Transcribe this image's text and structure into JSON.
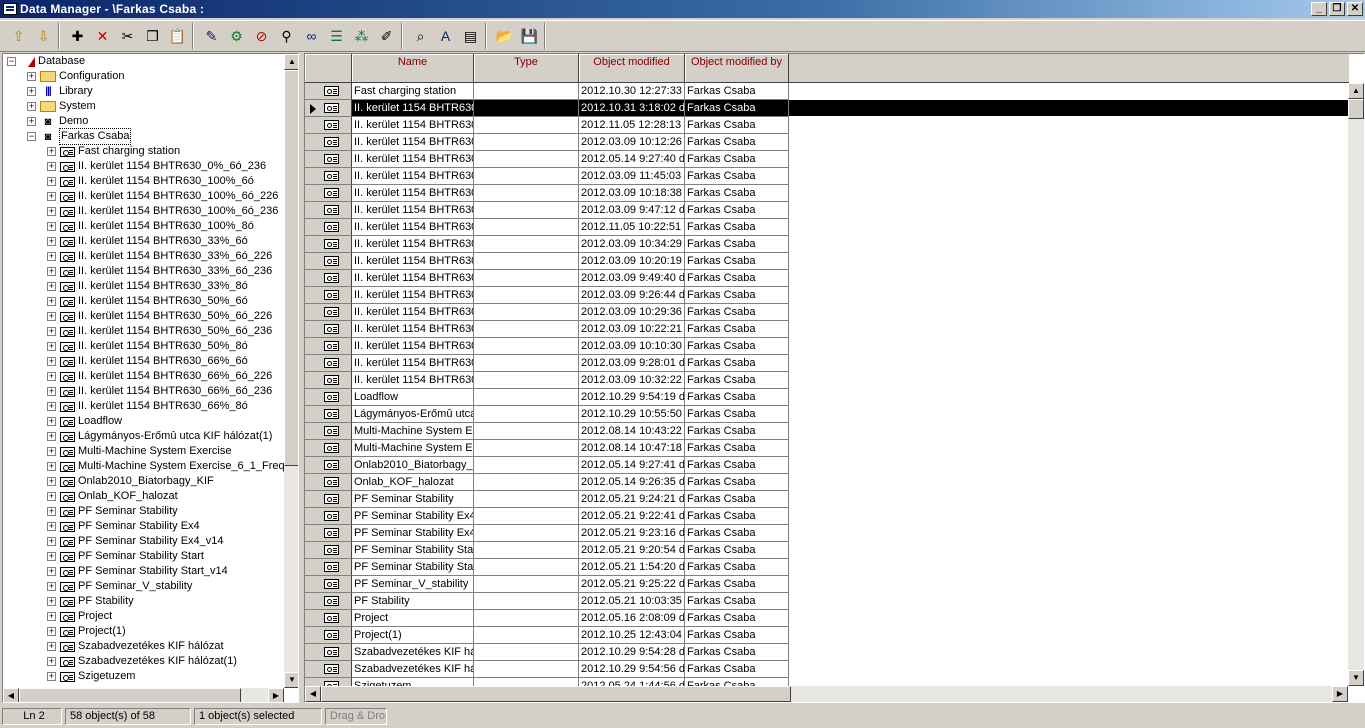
{
  "window": {
    "title": "Data Manager - \\Farkas Csaba :",
    "buttons": [
      "minimize",
      "restore",
      "close"
    ]
  },
  "toolbar": {
    "groups": [
      [
        {
          "icon": "folder-up-icon",
          "glyph": "⇧"
        },
        {
          "icon": "folder-down-icon",
          "glyph": "⇩"
        }
      ],
      [
        {
          "icon": "new-object-icon",
          "glyph": "✚"
        },
        {
          "icon": "delete-icon",
          "glyph": "✕"
        },
        {
          "icon": "cut-icon",
          "glyph": "✂"
        },
        {
          "icon": "copy-icon",
          "glyph": "❐"
        },
        {
          "icon": "paste-icon",
          "glyph": "📋"
        }
      ],
      [
        {
          "icon": "edit-icon",
          "glyph": "✎"
        },
        {
          "icon": "settings-icon",
          "glyph": "⚙"
        },
        {
          "icon": "no-entry-icon",
          "glyph": "⊘"
        },
        {
          "icon": "find-user-icon",
          "glyph": "⚲"
        },
        {
          "icon": "glasses-icon",
          "glyph": "∞"
        },
        {
          "icon": "filter-icon",
          "glyph": "☰"
        },
        {
          "icon": "network-icon",
          "glyph": "⁂"
        },
        {
          "icon": "note-icon",
          "glyph": "✐"
        }
      ],
      [
        {
          "icon": "binoculars-icon",
          "glyph": "⌕"
        },
        {
          "icon": "font-icon",
          "glyph": "A"
        },
        {
          "icon": "report-icon",
          "glyph": "▤"
        }
      ],
      [
        {
          "icon": "open-folder-icon",
          "glyph": "📂"
        },
        {
          "icon": "save-icon",
          "glyph": "💾"
        }
      ]
    ]
  },
  "tree": {
    "root": "Database",
    "top_items": [
      {
        "label": "Configuration",
        "icon": "folder"
      },
      {
        "label": "Library",
        "icon": "library"
      },
      {
        "label": "System",
        "icon": "folder"
      },
      {
        "label": "Demo",
        "icon": "user"
      }
    ],
    "user": {
      "label": "Farkas Csaba",
      "selected": true
    },
    "children": [
      "Fast charging station",
      "II. kerület 1154 BHTR630_0%_6ó_236",
      "II. kerület 1154 BHTR630_100%_6ó",
      "II. kerület 1154 BHTR630_100%_6ó_226",
      "II. kerület 1154 BHTR630_100%_6ó_236",
      "II. kerület 1154 BHTR630_100%_8ó",
      "II. kerület 1154 BHTR630_33%_6ó",
      "II. kerület 1154 BHTR630_33%_6ó_226",
      "II. kerület 1154 BHTR630_33%_6ó_236",
      "II. kerület 1154 BHTR630_33%_8ó",
      "II. kerület 1154 BHTR630_50%_6ó",
      "II. kerület 1154 BHTR630_50%_6ó_226",
      "II. kerület 1154 BHTR630_50%_6ó_236",
      "II. kerület 1154 BHTR630_50%_8ó",
      "II. kerület 1154 BHTR630_66%_6ó",
      "II. kerület 1154 BHTR630_66%_6ó_226",
      "II. kerület 1154 BHTR630_66%_6ó_236",
      "II. kerület 1154 BHTR630_66%_8ó",
      "Loadflow",
      "Lágymányos-Erőmû utca KIF hálózat(1)",
      "Multi-Machine System Exercise",
      "Multi-Machine System Exercise_6_1_Freq",
      "Onlab2010_Biatorbagy_KIF",
      "Onlab_KOF_halozat",
      "PF Seminar Stability",
      "PF Seminar Stability Ex4",
      "PF Seminar Stability Ex4_v14",
      "PF Seminar Stability Start",
      "PF Seminar Stability Start_v14",
      "PF Seminar_V_stability",
      "PF Stability",
      "Project",
      "Project(1)",
      "Szabadvezetékes KIF hálózat",
      "Szabadvezetékes KIF hálózat(1)",
      "Szigetuzem"
    ]
  },
  "grid": {
    "columns": [
      "Name",
      "Type",
      "Object modified",
      "Object modified by"
    ],
    "selected_row": 1,
    "rows": [
      [
        "Fast charging station",
        "",
        "2012.10.30 12:27:33",
        "Farkas Csaba"
      ],
      [
        "II. kerület 1154 BHTR630",
        "",
        "2012.10.31 3:18:02 d",
        "Farkas Csaba"
      ],
      [
        "II. kerület 1154 BHTR630",
        "",
        "2012.11.05 12:28:13",
        "Farkas Csaba"
      ],
      [
        "II. kerület 1154 BHTR630",
        "",
        "2012.03.09 10:12:26",
        "Farkas Csaba"
      ],
      [
        "II. kerület 1154 BHTR630",
        "",
        "2012.05.14 9:27:40 d",
        "Farkas Csaba"
      ],
      [
        "II. kerület 1154 BHTR630",
        "",
        "2012.03.09 11:45:03",
        "Farkas Csaba"
      ],
      [
        "II. kerület 1154 BHTR630",
        "",
        "2012.03.09 10:18:38",
        "Farkas Csaba"
      ],
      [
        "II. kerület 1154 BHTR630",
        "",
        "2012.03.09 9:47:12 d",
        "Farkas Csaba"
      ],
      [
        "II. kerület 1154 BHTR630",
        "",
        "2012.11.05 10:22:51",
        "Farkas Csaba"
      ],
      [
        "II. kerület 1154 BHTR630",
        "",
        "2012.03.09 10:34:29",
        "Farkas Csaba"
      ],
      [
        "II. kerület 1154 BHTR630",
        "",
        "2012.03.09 10:20:19",
        "Farkas Csaba"
      ],
      [
        "II. kerület 1154 BHTR630",
        "",
        "2012.03.09 9:49:40 d",
        "Farkas Csaba"
      ],
      [
        "II. kerület 1154 BHTR630",
        "",
        "2012.03.09 9:26:44 d",
        "Farkas Csaba"
      ],
      [
        "II. kerület 1154 BHTR630",
        "",
        "2012.03.09 10:29:36",
        "Farkas Csaba"
      ],
      [
        "II. kerület 1154 BHTR630",
        "",
        "2012.03.09 10:22:21",
        "Farkas Csaba"
      ],
      [
        "II. kerület 1154 BHTR630",
        "",
        "2012.03.09 10:10:30",
        "Farkas Csaba"
      ],
      [
        "II. kerület 1154 BHTR630",
        "",
        "2012.03.09 9:28:01 d",
        "Farkas Csaba"
      ],
      [
        "II. kerület 1154 BHTR630",
        "",
        "2012.03.09 10:32:22",
        "Farkas Csaba"
      ],
      [
        "Loadflow",
        "",
        "2012.10.29 9:54:19 d",
        "Farkas Csaba"
      ],
      [
        "Lágymányos-Erőmû utca",
        "",
        "2012.10.29 10:55:50",
        "Farkas Csaba"
      ],
      [
        "Multi-Machine System Ex",
        "",
        "2012.08.14 10:43:22",
        "Farkas Csaba"
      ],
      [
        "Multi-Machine System Ex",
        "",
        "2012.08.14 10:47:18",
        "Farkas Csaba"
      ],
      [
        "Onlab2010_Biatorbagy_K",
        "",
        "2012.05.14 9:27:41 d",
        "Farkas Csaba"
      ],
      [
        "Onlab_KOF_halozat",
        "",
        "2012.05.14 9:26:35 d",
        "Farkas Csaba"
      ],
      [
        "PF Seminar Stability",
        "",
        "2012.05.21 9:24:21 d",
        "Farkas Csaba"
      ],
      [
        "PF Seminar Stability Ex4",
        "",
        "2012.05.21 9:22:41 d",
        "Farkas Csaba"
      ],
      [
        "PF Seminar Stability Ex4_",
        "",
        "2012.05.21 9:23:16 d",
        "Farkas Csaba"
      ],
      [
        "PF Seminar Stability Start",
        "",
        "2012.05.21 9:20:54 d",
        "Farkas Csaba"
      ],
      [
        "PF Seminar Stability Start",
        "",
        "2012.05.21 1:54:20 d",
        "Farkas Csaba"
      ],
      [
        "PF Seminar_V_stability",
        "",
        "2012.05.21 9:25:22 d",
        "Farkas Csaba"
      ],
      [
        "PF Stability",
        "",
        "2012.05.21 10:03:35",
        "Farkas Csaba"
      ],
      [
        "Project",
        "",
        "2012.05.16 2:08:09 d",
        "Farkas Csaba"
      ],
      [
        "Project(1)",
        "",
        "2012.10.25 12:43:04",
        "Farkas Csaba"
      ],
      [
        "Szabadvezetékes KIF há",
        "",
        "2012.10.29 9:54:28 d",
        "Farkas Csaba"
      ],
      [
        "Szabadvezetékes KIF há",
        "",
        "2012.10.29 9:54:56 d",
        "Farkas Csaba"
      ],
      [
        "Szigetuzem",
        "",
        "2012.05.24 1:44:56 d",
        "Farkas Csaba"
      ]
    ]
  },
  "status": {
    "line": "Ln 2",
    "objects": "58 object(s) of 58",
    "selected": "1 object(s) selected",
    "drag_drop": "Drag & Drop"
  }
}
